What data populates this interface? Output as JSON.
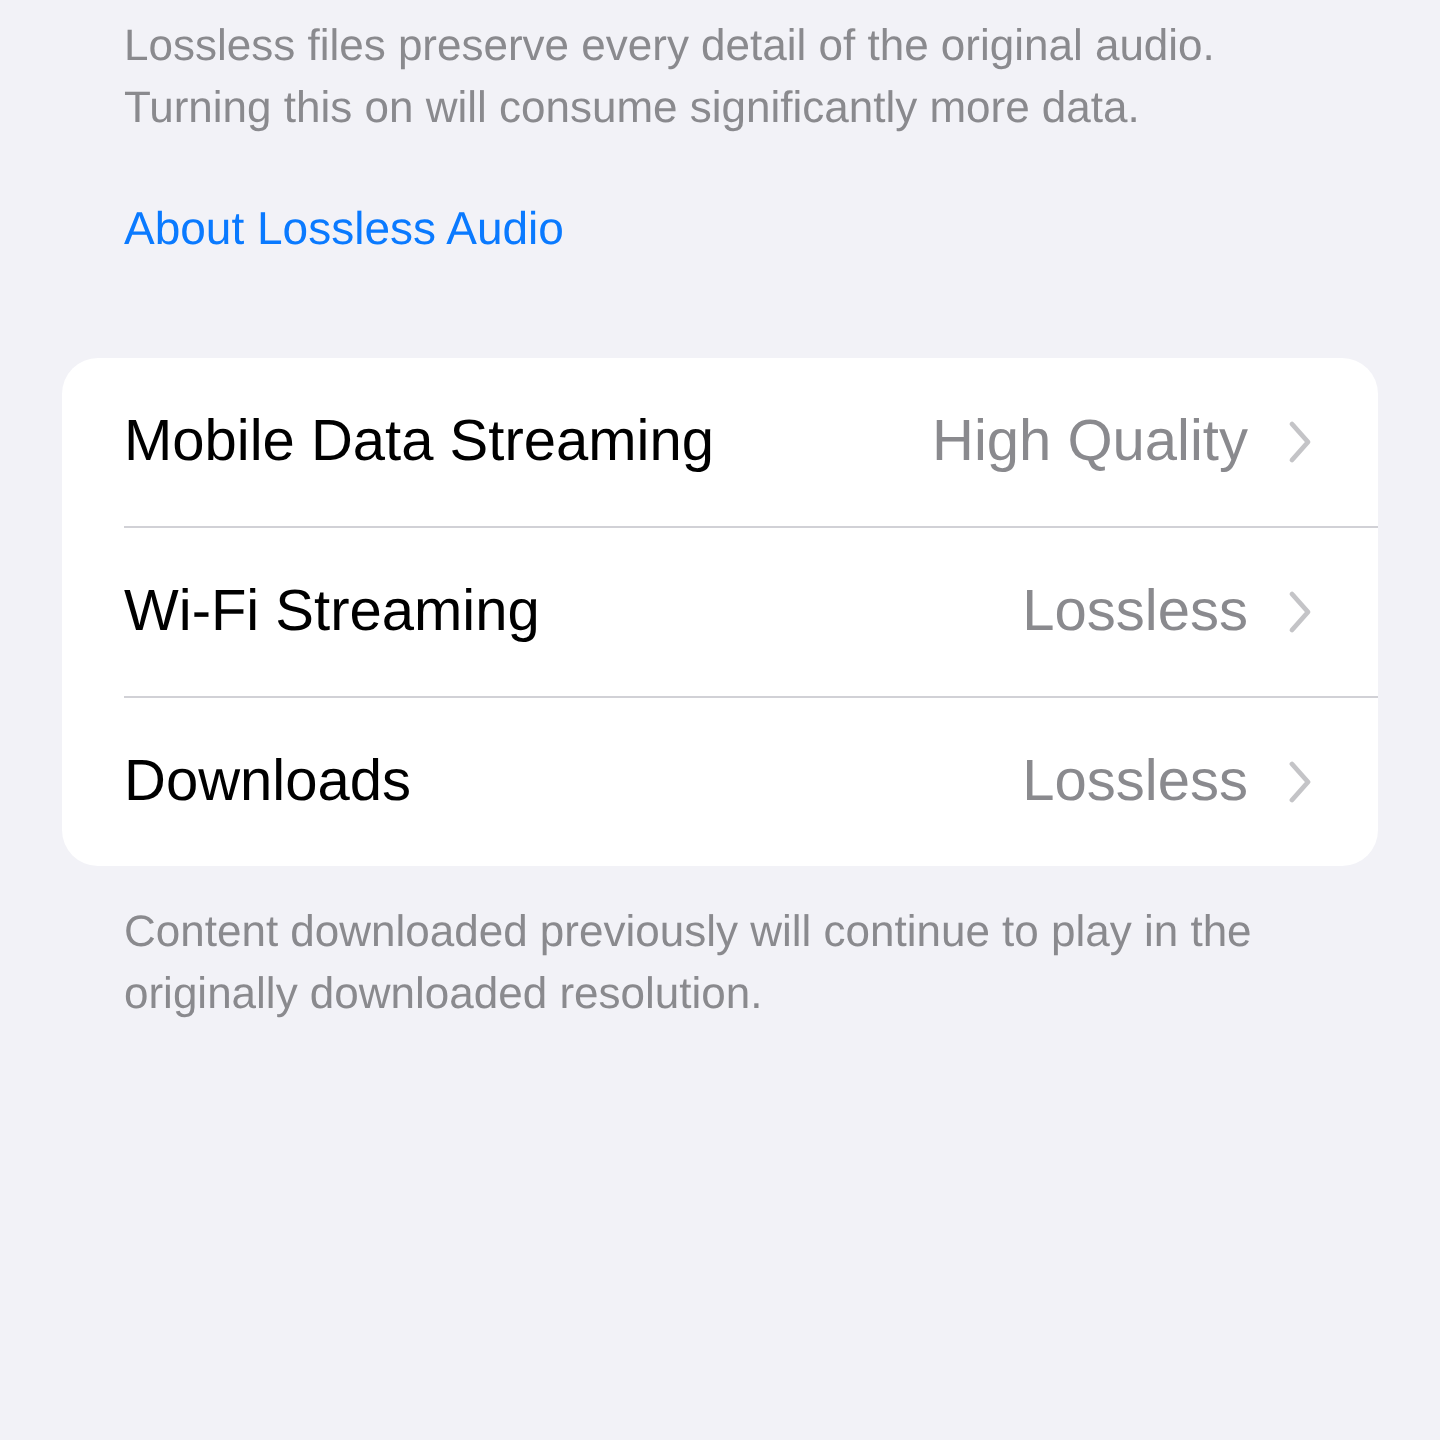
{
  "header_note": "Lossless files preserve every detail of the original audio. Turning this on will consume significantly more data.",
  "link": "About Lossless Audio",
  "settings": [
    {
      "label": "Mobile Data Streaming",
      "value": "High Quality"
    },
    {
      "label": "Wi-Fi Streaming",
      "value": "Lossless"
    },
    {
      "label": "Downloads",
      "value": "Lossless"
    }
  ],
  "footer_note": "Content downloaded previously will continue to play in the originally downloaded resolution."
}
